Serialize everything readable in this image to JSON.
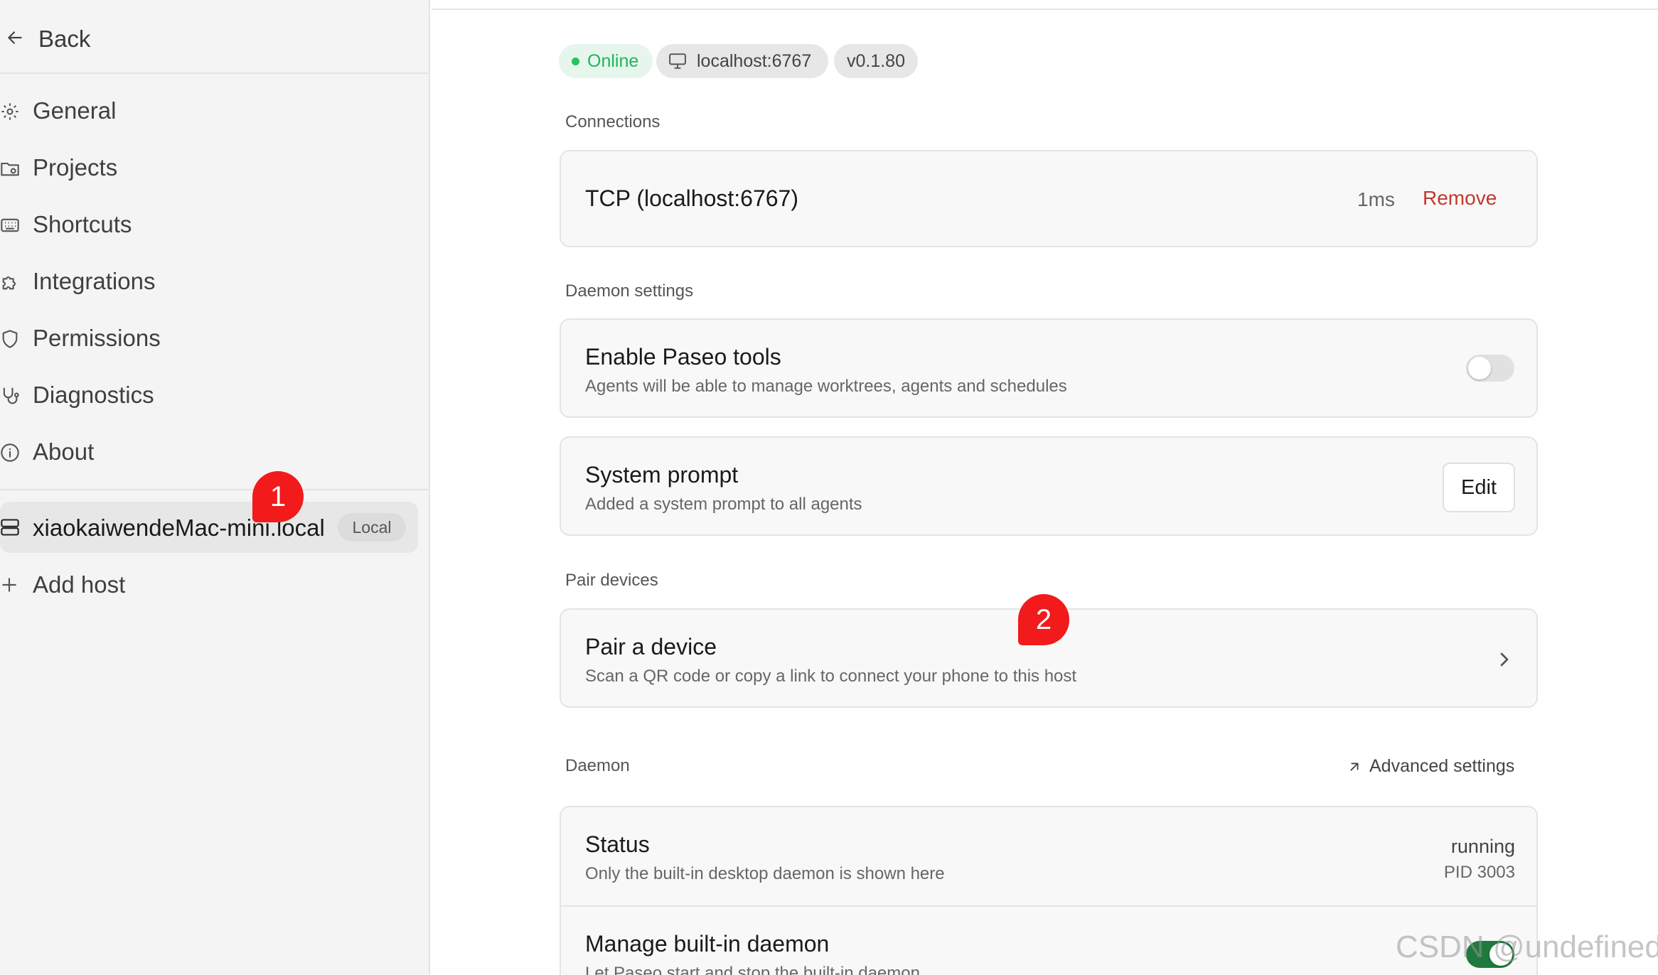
{
  "sidebar": {
    "back_label": "Back",
    "items": [
      {
        "label": "General",
        "icon": "gear-icon"
      },
      {
        "label": "Projects",
        "icon": "folder-icon"
      },
      {
        "label": "Shortcuts",
        "icon": "keyboard-icon"
      },
      {
        "label": "Integrations",
        "icon": "puzzle-icon"
      },
      {
        "label": "Permissions",
        "icon": "shield-icon"
      },
      {
        "label": "Diagnostics",
        "icon": "stethoscope-icon"
      },
      {
        "label": "About",
        "icon": "info-icon"
      }
    ],
    "host": {
      "name": "xiaokaiwendeMac-mini.local",
      "badge": "Local",
      "icon": "server-icon"
    },
    "add_host_label": "Add host"
  },
  "markers": [
    "1",
    "2"
  ],
  "header": {
    "status": "Online",
    "host": "localhost:6767",
    "version": "v0.1.80"
  },
  "connections": {
    "label": "Connections",
    "items": [
      {
        "name": "TCP (localhost:6767)",
        "latency": "1ms",
        "action": "Remove"
      }
    ]
  },
  "daemon_settings": {
    "label": "Daemon settings",
    "paseo_tools": {
      "title": "Enable Paseo tools",
      "desc": "Agents will be able to manage worktrees, agents and schedules",
      "enabled": false
    },
    "system_prompt": {
      "title": "System prompt",
      "desc": "Added a system prompt to all agents",
      "button": "Edit"
    }
  },
  "pair_devices": {
    "label": "Pair devices",
    "title": "Pair a device",
    "desc": "Scan a QR code or copy a link to connect your phone to this host"
  },
  "daemon": {
    "label": "Daemon",
    "advanced_label": "Advanced settings",
    "status": {
      "title": "Status",
      "desc": "Only the built-in desktop daemon is shown here",
      "value": "running",
      "pid": "PID 3003"
    },
    "manage": {
      "title": "Manage built-in daemon",
      "desc": "Let Paseo start and stop the built-in daemon",
      "enabled": true
    }
  },
  "watermark": "CSDN @undefined",
  "colors": {
    "online": "#24b35a",
    "remove": "#c0392b",
    "toggle_on": "#1f7a3d",
    "marker": "#f21a1a"
  }
}
